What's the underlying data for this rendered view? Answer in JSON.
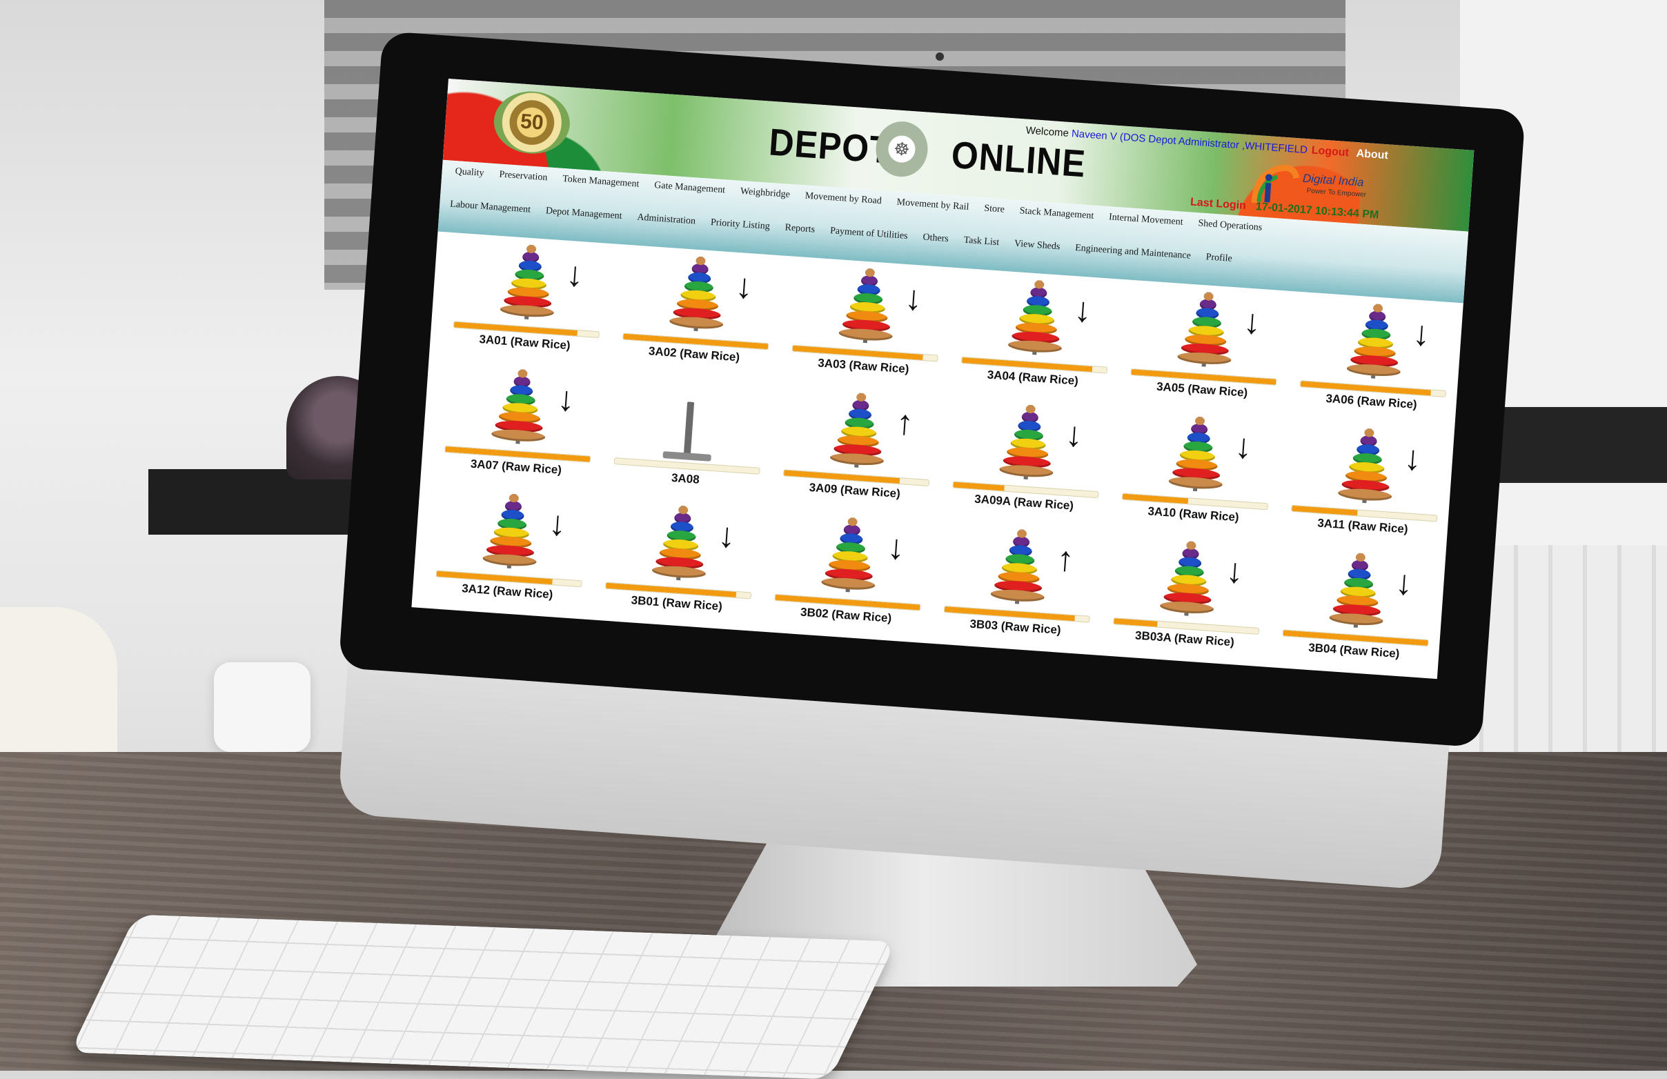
{
  "header": {
    "title_left": "DEPOT",
    "title_right": "ONLINE",
    "welcome_prefix": "Welcome",
    "user": "Naveen V (DOS Depot Administrator ,WHITEFIELD",
    "logout": "Logout",
    "about": "About",
    "emblem_text": "50",
    "digital_india": "Digital India",
    "digital_india_sub": "Power To Empower",
    "last_login_label": "Last Login",
    "last_login_time": "17-01-2017 10:13:44 PM"
  },
  "nav": {
    "row1": [
      "Quality",
      "Preservation",
      "Token Management",
      "Gate Management",
      "Weighbridge",
      "Movement by Road",
      "Movement by Rail",
      "Store",
      "Stack Management",
      "Internal Movement",
      "Shed Operations"
    ],
    "row2": [
      "Labour Management",
      "Depot Management",
      "Administration",
      "Priority Listing",
      "Reports",
      "Payment of Utilities",
      "Others",
      "Task List",
      "View Sheds",
      "Engineering and Maintenance",
      "Profile"
    ]
  },
  "bins": [
    {
      "label": "3A01 (Raw Rice)",
      "arrow": "down",
      "fill": 0.85
    },
    {
      "label": "3A02 (Raw Rice)",
      "arrow": "down",
      "fill": 1.0
    },
    {
      "label": "3A03 (Raw Rice)",
      "arrow": "down",
      "fill": 0.9
    },
    {
      "label": "3A04 (Raw Rice)",
      "arrow": "down",
      "fill": 0.9
    },
    {
      "label": "3A05 (Raw Rice)",
      "arrow": "down",
      "fill": 1.0
    },
    {
      "label": "3A06 (Raw Rice)",
      "arrow": "down",
      "fill": 0.9
    },
    {
      "label": "3A07 (Raw Rice)",
      "arrow": "down",
      "fill": 1.0
    },
    {
      "label": "3A08",
      "arrow": "none",
      "fill": 0.0
    },
    {
      "label": "3A09 (Raw Rice)",
      "arrow": "up",
      "fill": 0.8
    },
    {
      "label": "3A09A (Raw Rice)",
      "arrow": "down",
      "fill": 0.35
    },
    {
      "label": "3A10 (Raw Rice)",
      "arrow": "down",
      "fill": 0.45
    },
    {
      "label": "3A11 (Raw Rice)",
      "arrow": "down",
      "fill": 0.45
    },
    {
      "label": "3A12 (Raw Rice)",
      "arrow": "down",
      "fill": 0.8
    },
    {
      "label": "3B01 (Raw Rice)",
      "arrow": "down",
      "fill": 0.9
    },
    {
      "label": "3B02 (Raw Rice)",
      "arrow": "down",
      "fill": 1.0
    },
    {
      "label": "3B03 (Raw Rice)",
      "arrow": "up",
      "fill": 0.9
    },
    {
      "label": "3B03A (Raw Rice)",
      "arrow": "down",
      "fill": 0.3
    },
    {
      "label": "3B04 (Raw Rice)",
      "arrow": "down",
      "fill": 1.0
    }
  ],
  "colors": {
    "bar_fill": "#f29a10",
    "ring_colors": [
      "#6a2a8a",
      "#1d4fc8",
      "#2aa640",
      "#f0d010",
      "#f08a10",
      "#e02020",
      "#c98a4a"
    ]
  },
  "device": {
    "apple_glyph": ""
  }
}
